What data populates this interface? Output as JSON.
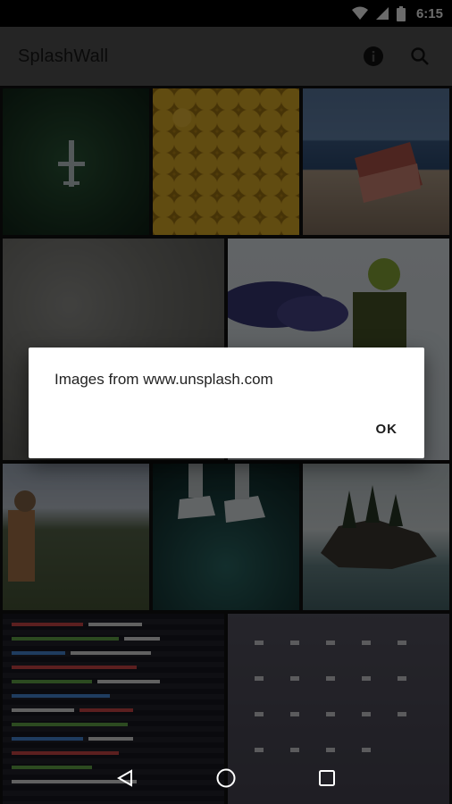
{
  "status_bar": {
    "time": "6:15"
  },
  "app_bar": {
    "title": "SplashWall",
    "info_icon": "info-icon",
    "search_icon": "search-icon"
  },
  "grid": {
    "tiles": [
      {
        "name": "forest-airplane-photo"
      },
      {
        "name": "yellow-faces-photo"
      },
      {
        "name": "beach-armchair-photo"
      },
      {
        "name": "concrete-wall-photo"
      },
      {
        "name": "smoke-masked-person-photo"
      },
      {
        "name": "astronaut-field-photo"
      },
      {
        "name": "floating-sneakers-photo"
      },
      {
        "name": "rock-island-photo"
      },
      {
        "name": "code-screen-photo"
      },
      {
        "name": "cctv-wall-photo"
      }
    ]
  },
  "dialog": {
    "message": "Images from www.unsplash.com",
    "ok_label": "OK"
  },
  "nav_bar": {
    "back_icon": "back-icon",
    "home_icon": "home-icon",
    "recents_icon": "recents-icon"
  }
}
